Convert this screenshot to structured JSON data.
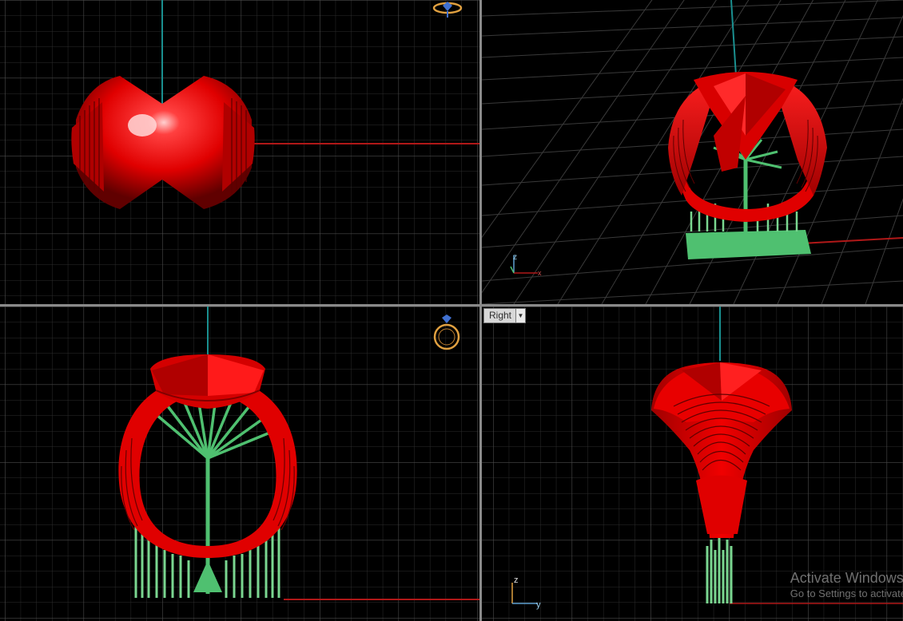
{
  "viewports": {
    "top": {
      "label": ""
    },
    "perspective": {
      "label": ""
    },
    "front": {
      "label": ""
    },
    "right": {
      "label": "Right"
    }
  },
  "axis_labels": {
    "z": "z",
    "x": "x",
    "y": "y"
  },
  "watermark": {
    "title": "Activate Windows",
    "subtitle": "Go to Settings to activate"
  },
  "colors": {
    "background": "#000000",
    "grid_minor": "#2c2c2c",
    "grid_major": "#464646",
    "x_axis": "#b01818",
    "z_axis": "#1a8f8f",
    "model_red": "#e00000",
    "supports_green": "#4fc070"
  }
}
